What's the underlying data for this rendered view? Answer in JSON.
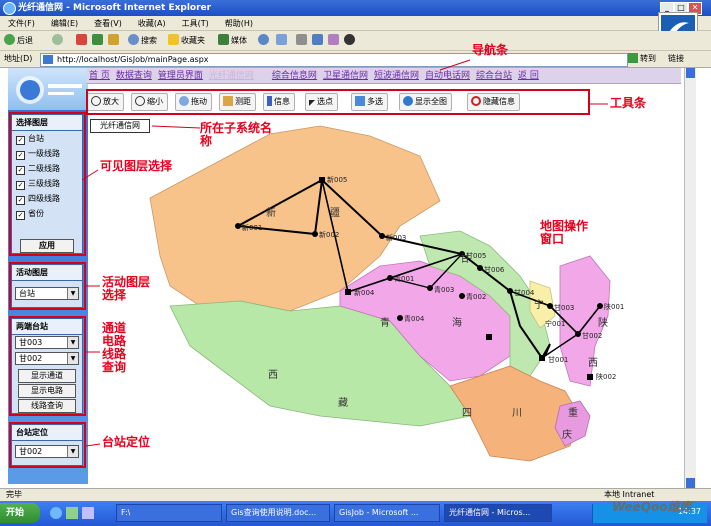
{
  "window": {
    "title": "光纤通信网 - Microsoft Internet Explorer"
  },
  "menu": [
    "文件(F)",
    "编辑(E)",
    "查看(V)",
    "收藏(A)",
    "工具(T)",
    "帮助(H)"
  ],
  "ie_toolbar": {
    "back": "后退",
    "search": "搜索",
    "favorites": "收藏夹",
    "media": "媒体"
  },
  "address": {
    "label": "地址(D)",
    "url": "http://localhost/GisJob/mainPage.aspx",
    "go": "转到",
    "links": "链接"
  },
  "navbar": {
    "items": [
      "首 页",
      "数据查询",
      "管理员界面",
      "光纤通信网",
      "综合信息网",
      "卫星通信网",
      "短波通信网",
      "自动电话网",
      "综合台站",
      "返 回"
    ],
    "faded_index": 3
  },
  "map_toolbar": [
    "放大",
    "缩小",
    "拖动",
    "测距",
    "信息",
    "选点",
    "多选",
    "显示全图",
    "隐藏信息"
  ],
  "subsystem_label": "光纤通信网",
  "layers_panel": {
    "title": "选择图层",
    "items": [
      "台站",
      "一级线路",
      "二级线路",
      "三级线路",
      "四级线路",
      "省份"
    ],
    "apply": "应用"
  },
  "active_layer_panel": {
    "title": "活动图层",
    "value": "台站"
  },
  "query_panel": {
    "title": "两端台站",
    "from": "甘003",
    "to": "甘002",
    "btn_channel": "显示通道",
    "btn_circuit": "显示电路",
    "btn_line": "线路查询"
  },
  "locate_panel": {
    "title": "台站定位",
    "value": "甘002"
  },
  "callouts": {
    "nav": "导航条",
    "tools": "工具条",
    "subsystem": "所在子系统名称",
    "layers": "可见图层选择",
    "active": "活动图层选择",
    "query": "通道电路线路查询",
    "map": "地图操作窗口",
    "locate": "台站定位"
  },
  "map_labels": {
    "xinjiang": [
      "新",
      "疆"
    ],
    "qinghai": [
      "青",
      "海"
    ],
    "gansu": [
      "甘"
    ],
    "xizang": [
      "西",
      "藏"
    ],
    "sichuan": [
      "四",
      "川"
    ],
    "shaanxi": [
      "陕",
      "西"
    ],
    "ningxia": [
      "宁"
    ],
    "chongqing": [
      "重",
      "庆"
    ]
  },
  "stations": [
    "新005",
    "新001",
    "新002",
    "新003",
    "新004",
    "甘005",
    "甘006",
    "甘004",
    "甘002",
    "甘003",
    "甘001",
    "青001",
    "青002",
    "青003",
    "青004",
    "陕001",
    "陕002",
    "宁001"
  ],
  "status": {
    "left": "完毕",
    "right": "本地 Intranet"
  },
  "taskbar": {
    "start": "开始",
    "tasks": [
      "F:\\",
      "Gis查询使用说明.doc...",
      "GisJob - Microsoft ...",
      "光纤通信网 - Micros..."
    ],
    "active_index": 3,
    "clock": "14:37"
  },
  "watermark": "WeeQoo维库"
}
